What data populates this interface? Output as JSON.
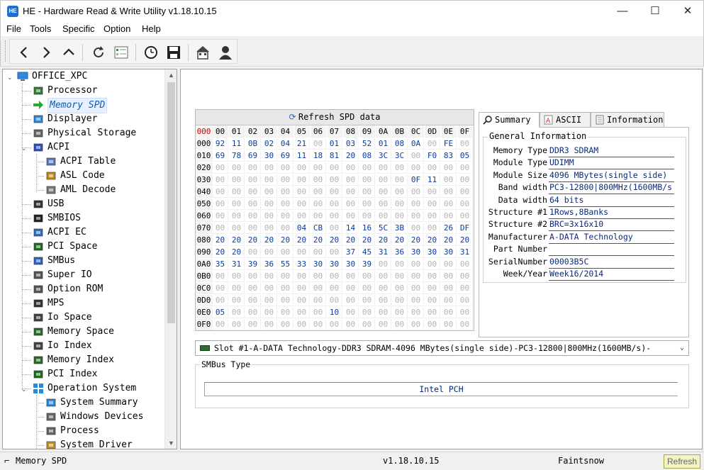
{
  "window": {
    "app_icon_text": "HE",
    "title": "HE - Hardware Read & Write Utility v1.18.10.15",
    "minimize": "—",
    "maximize": "☐",
    "close": "✕"
  },
  "menu": [
    "File",
    "Tools",
    "Specific",
    "Option",
    "Help"
  ],
  "toolbar": {
    "buttons": [
      "back-icon",
      "forward-icon",
      "up-icon",
      "refresh-icon",
      "checklist-icon",
      "clock-icon",
      "save-icon",
      "home-icon",
      "user-icon"
    ]
  },
  "tree": {
    "root": "OFFICE_XPC",
    "items": [
      {
        "label": "Processor",
        "icon": "processor-icon"
      },
      {
        "label": "Memory SPD",
        "icon": "arrow-right-icon",
        "selected": true
      },
      {
        "label": "Displayer",
        "icon": "monitor-icon"
      },
      {
        "label": "Physical Storage",
        "icon": "drive-icon"
      },
      {
        "label": "ACPI",
        "icon": "acpi-icon",
        "expanded": true
      },
      {
        "label": "ACPI Table",
        "icon": "table-icon",
        "indent": 2
      },
      {
        "label": "ASL Code",
        "icon": "code-icon",
        "indent": 2
      },
      {
        "label": "AML Decode",
        "icon": "decode-icon",
        "indent": 2
      },
      {
        "label": "USB",
        "icon": "usb-icon"
      },
      {
        "label": "SMBIOS",
        "icon": "smbios-icon"
      },
      {
        "label": "ACPI EC",
        "icon": "laptop-icon"
      },
      {
        "label": "PCI Space",
        "icon": "pci-icon"
      },
      {
        "label": "SMBus",
        "icon": "smbus-icon"
      },
      {
        "label": "Super IO",
        "icon": "superio-icon"
      },
      {
        "label": "Option ROM",
        "icon": "rom-icon"
      },
      {
        "label": "MPS",
        "icon": "mps-icon"
      },
      {
        "label": "Io Space",
        "icon": "io-icon"
      },
      {
        "label": "Memory Space",
        "icon": "memory-icon"
      },
      {
        "label": "Io Index",
        "icon": "io-index-icon"
      },
      {
        "label": "Memory Index",
        "icon": "memory-index-icon"
      },
      {
        "label": "PCI Index",
        "icon": "pci-index-icon"
      },
      {
        "label": "Operation System",
        "icon": "windows-icon",
        "expanded": true
      },
      {
        "label": "System Summary",
        "icon": "summary-icon",
        "indent": 2
      },
      {
        "label": "Windows Devices",
        "icon": "devices-icon",
        "indent": 2
      },
      {
        "label": "Process",
        "icon": "process-icon",
        "indent": 2
      },
      {
        "label": "System Driver",
        "icon": "driver-icon",
        "indent": 2
      }
    ]
  },
  "spd": {
    "refresh_label": "Refresh SPD data",
    "corner": "000",
    "columns": [
      "00",
      "01",
      "02",
      "03",
      "04",
      "05",
      "06",
      "07",
      "08",
      "09",
      "0A",
      "0B",
      "0C",
      "0D",
      "0E",
      "0F"
    ],
    "rows": [
      {
        "addr": "000",
        "cells": [
          "92",
          "11",
          "0B",
          "02",
          "04",
          "21",
          "00",
          "01",
          "03",
          "52",
          "01",
          "08",
          "0A",
          "00",
          "FE",
          "00"
        ]
      },
      {
        "addr": "010",
        "cells": [
          "69",
          "78",
          "69",
          "30",
          "69",
          "11",
          "18",
          "81",
          "20",
          "08",
          "3C",
          "3C",
          "00",
          "F0",
          "83",
          "05"
        ]
      },
      {
        "addr": "020",
        "cells": [
          "00",
          "00",
          "00",
          "00",
          "00",
          "00",
          "00",
          "00",
          "00",
          "00",
          "00",
          "00",
          "00",
          "00",
          "00",
          "00"
        ]
      },
      {
        "addr": "030",
        "cells": [
          "00",
          "00",
          "00",
          "00",
          "00",
          "00",
          "00",
          "00",
          "00",
          "00",
          "00",
          "00",
          "0F",
          "11",
          "00",
          "00"
        ]
      },
      {
        "addr": "040",
        "cells": [
          "00",
          "00",
          "00",
          "00",
          "00",
          "00",
          "00",
          "00",
          "00",
          "00",
          "00",
          "00",
          "00",
          "00",
          "00",
          "00"
        ]
      },
      {
        "addr": "050",
        "cells": [
          "00",
          "00",
          "00",
          "00",
          "00",
          "00",
          "00",
          "00",
          "00",
          "00",
          "00",
          "00",
          "00",
          "00",
          "00",
          "00"
        ]
      },
      {
        "addr": "060",
        "cells": [
          "00",
          "00",
          "00",
          "00",
          "00",
          "00",
          "00",
          "00",
          "00",
          "00",
          "00",
          "00",
          "00",
          "00",
          "00",
          "00"
        ]
      },
      {
        "addr": "070",
        "cells": [
          "00",
          "00",
          "00",
          "00",
          "00",
          "04",
          "CB",
          "00",
          "14",
          "16",
          "5C",
          "3B",
          "00",
          "00",
          "26",
          "DF"
        ]
      },
      {
        "addr": "080",
        "cells": [
          "20",
          "20",
          "20",
          "20",
          "20",
          "20",
          "20",
          "20",
          "20",
          "20",
          "20",
          "20",
          "20",
          "20",
          "20",
          "20"
        ]
      },
      {
        "addr": "090",
        "cells": [
          "20",
          "20",
          "00",
          "00",
          "00",
          "00",
          "00",
          "00",
          "37",
          "45",
          "31",
          "36",
          "30",
          "30",
          "30",
          "31"
        ]
      },
      {
        "addr": "0A0",
        "cells": [
          "35",
          "31",
          "39",
          "36",
          "55",
          "33",
          "30",
          "30",
          "30",
          "39",
          "00",
          "00",
          "00",
          "00",
          "00",
          "00"
        ]
      },
      {
        "addr": "0B0",
        "cells": [
          "00",
          "00",
          "00",
          "00",
          "00",
          "00",
          "00",
          "00",
          "00",
          "00",
          "00",
          "00",
          "00",
          "00",
          "00",
          "00"
        ]
      },
      {
        "addr": "0C0",
        "cells": [
          "00",
          "00",
          "00",
          "00",
          "00",
          "00",
          "00",
          "00",
          "00",
          "00",
          "00",
          "00",
          "00",
          "00",
          "00",
          "00"
        ]
      },
      {
        "addr": "0D0",
        "cells": [
          "00",
          "00",
          "00",
          "00",
          "00",
          "00",
          "00",
          "00",
          "00",
          "00",
          "00",
          "00",
          "00",
          "00",
          "00",
          "00"
        ]
      },
      {
        "addr": "0E0",
        "cells": [
          "05",
          "00",
          "00",
          "00",
          "00",
          "00",
          "00",
          "10",
          "00",
          "00",
          "00",
          "00",
          "00",
          "00",
          "00",
          "00"
        ]
      },
      {
        "addr": "0F0",
        "cells": [
          "00",
          "00",
          "00",
          "00",
          "00",
          "00",
          "00",
          "00",
          "00",
          "00",
          "00",
          "00",
          "00",
          "00",
          "00",
          "00"
        ]
      }
    ]
  },
  "tabs": [
    {
      "label": "Summary",
      "icon": "search-icon",
      "active": true
    },
    {
      "label": "ASCII",
      "icon": "ascii-icon"
    },
    {
      "label": "Information",
      "icon": "document-icon"
    }
  ],
  "summary": {
    "group_title": "General Information",
    "fields": [
      {
        "key": "Memory Type",
        "value": "DDR3 SDRAM"
      },
      {
        "key": "Module Type",
        "value": "UDIMM"
      },
      {
        "key": "Module Size",
        "value": "4096 MBytes(single side)"
      },
      {
        "key": "Band width",
        "value": "PC3-12800|800MHz(1600MB/s"
      },
      {
        "key": "Data width",
        "value": "64 bits"
      },
      {
        "key": "Structure #1",
        "value": "1Rows,8Banks"
      },
      {
        "key": "Structure #2",
        "value": "BRC=3x16x10"
      },
      {
        "key": "Manufacturer",
        "value": "A-DATA Technology"
      },
      {
        "key": "Part Number",
        "value": ""
      },
      {
        "key": "SerialNumber",
        "value": "00003B5C"
      },
      {
        "key": "Week/Year",
        "value": "Week16/2014"
      }
    ]
  },
  "slot": {
    "selected": "Slot #1-A-DATA Technology-DDR3 SDRAM-4096 MBytes(single side)-PC3-12800|800MHz(1600MB/s)-"
  },
  "smbus": {
    "title": "SMBus Type",
    "value": "Intel PCH"
  },
  "status": {
    "current": "Memory SPD",
    "version": "v1.18.10.15",
    "author": "Faintsnow",
    "refresh": "Refresh"
  }
}
